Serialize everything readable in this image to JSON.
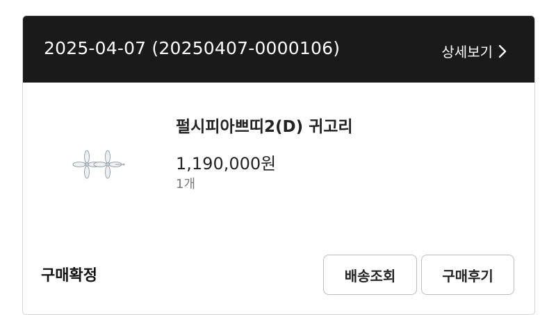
{
  "order": {
    "header_text": "2025-04-07 (20250407-0000106)",
    "detail_link_label": "상세보기"
  },
  "product": {
    "name": "펄시피아쁘띠2(D) 귀고리",
    "price": "1,190,000원",
    "quantity": "1개",
    "image_icon": "earring-product-thumbnail"
  },
  "footer": {
    "status_label": "구매확정",
    "track_button_label": "배송조회",
    "review_button_label": "구매후기"
  },
  "colors": {
    "header_bg": "#1a1a1a",
    "header_text": "#ffffff",
    "border": "#d6d6d6",
    "qty_text": "#777777"
  }
}
